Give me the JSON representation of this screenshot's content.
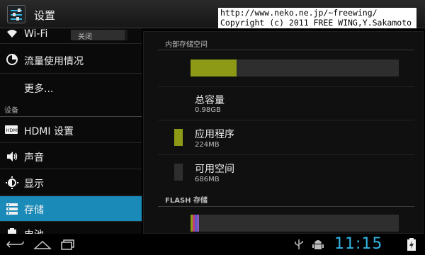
{
  "app": {
    "title": "设置"
  },
  "watermark": {
    "line1": "http://www.neko.ne.jp/~freewing/",
    "line2": "Copyright (c) 2011 FREE WING,Y.Sakamoto"
  },
  "sidebar": {
    "wifi": {
      "label": "Wi-Fi",
      "toggle": "关闭"
    },
    "items": [
      {
        "label": "流量使用情况"
      },
      {
        "label": "更多..."
      }
    ],
    "device_header": "设备",
    "device_items": [
      {
        "label": "HDMI 设置"
      },
      {
        "label": "声音"
      },
      {
        "label": "显示"
      },
      {
        "label": "存储"
      },
      {
        "label": "电池"
      }
    ]
  },
  "storage": {
    "internal_header": "内部存储空间",
    "used_fraction": 0.22,
    "total": {
      "title": "总容量",
      "value": "0.98GB"
    },
    "apps": {
      "title": "应用程序",
      "value": "224MB",
      "color": "#8d9a16"
    },
    "available": {
      "title": "可用空间",
      "value": "686MB",
      "color": "#2e2e2e"
    },
    "flash_header": "FLASH 存储"
  },
  "statusbar": {
    "time": "11:15",
    "accent": "#33b5e5"
  }
}
